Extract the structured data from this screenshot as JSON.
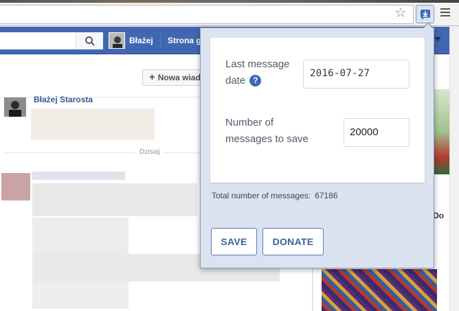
{
  "browser": {
    "star_icon": "bookmark-star-icon",
    "extension_icon": "save-messages-extension-icon",
    "menu_icon": "hamburger-menu-icon"
  },
  "facebook": {
    "user_name": "Błażej",
    "home_label": "Strona g",
    "new_message_label": "Nowa wiad",
    "new_message_plus": "+",
    "sender_name": "Błażej Starosta",
    "day_divider": "Dzisiaj",
    "right_label": "Do",
    "accent_color": "#4267b2"
  },
  "popup": {
    "last_message_label": "Last message date",
    "help_icon": "?",
    "last_message_value": "2016-07-27",
    "number_label": "Number of messages to save",
    "number_value": "20000",
    "total_label": "Total number of messages:",
    "total_value": "67186",
    "save_label": "SAVE",
    "donate_label": "DONATE",
    "background_color": "#dbe3f0",
    "button_color": "#3d5f9a"
  }
}
